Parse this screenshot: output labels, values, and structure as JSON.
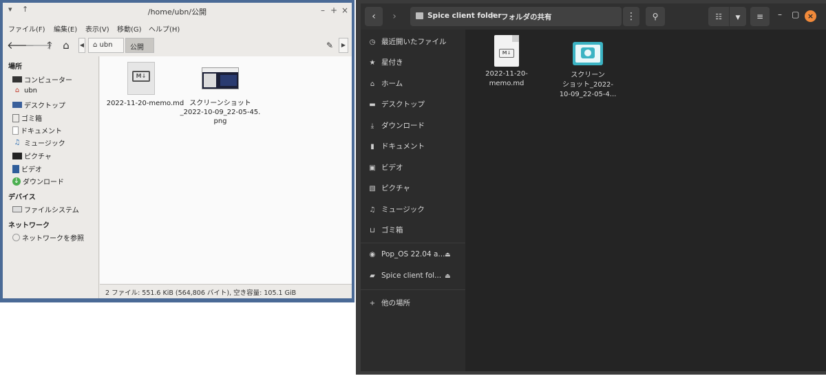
{
  "left_window": {
    "title": "/home/ubn/公開",
    "titlebar": {
      "menu_arrow": "▾",
      "up_arrow": "↑",
      "minimize": "–",
      "maximize": "+",
      "close": "×"
    },
    "menu": [
      "ファイル(F)",
      "編集(E)",
      "表示(V)",
      "移動(G)",
      "ヘルプ(H)"
    ],
    "toolbar": {
      "back": "🡐",
      "forward": "🡒",
      "up": "🡑",
      "home": "⌂",
      "edit": "✎"
    },
    "breadcrumbs": [
      "ubn",
      "公開"
    ],
    "sidebar": {
      "places_header": "場所",
      "places": [
        "コンピューター",
        "ubn",
        "デスクトップ",
        "ゴミ箱",
        "ドキュメント",
        "ミュージック",
        "ピクチャ",
        "ビデオ",
        "ダウンロード"
      ],
      "devices_header": "デバイス",
      "devices": [
        "ファイルシステム"
      ],
      "network_header": "ネットワーク",
      "network": [
        "ネットワークを参照"
      ]
    },
    "files": [
      {
        "name": "2022-11-20-memo.md",
        "badge": "M↓"
      },
      {
        "name_lines": [
          "スクリーンショット",
          "_2022-10-09_22-05-45.",
          "png"
        ]
      }
    ],
    "status": "2 ファイル: 551.6 KiB (564,806 バイト), 空き容量: 105.1 GiB"
  },
  "right_window": {
    "path": [
      "Spice client folder",
      "フォルダの共有"
    ],
    "path_separator": "/",
    "sidebar": {
      "items": [
        "最近開いたファイル",
        "星付き",
        "ホーム",
        "デスクトップ",
        "ダウンロード",
        "ドキュメント",
        "ビデオ",
        "ピクチャ",
        "ミュージック",
        "ゴミ箱"
      ],
      "mounts": [
        "Pop_OS 22.04 a...",
        "Spice client fol..."
      ],
      "other": "他の場所"
    },
    "files": [
      {
        "name_lines": [
          "2022-11-20-",
          "memo.md"
        ],
        "badge": "M↓"
      },
      {
        "name_lines": [
          "スクリーン",
          "ショット_2022-",
          "10-09_22-05-4..."
        ]
      }
    ],
    "accent_close": "#f28a3a",
    "image_icon_color": "#3bb3c3"
  }
}
